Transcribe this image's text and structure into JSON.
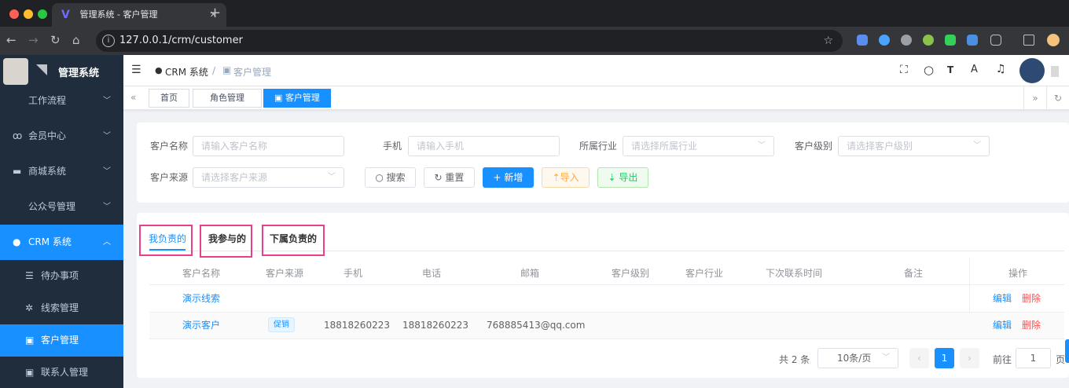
{
  "browser": {
    "tab_title": "管理系统 - 客户管理",
    "url": "127.0.0.1/crm/customer",
    "new_tab": "+",
    "close": "✕"
  },
  "logo": {
    "title": "管理系统"
  },
  "sidebar": {
    "items": [
      {
        "label": "工作流程",
        "icon": "chevron"
      },
      {
        "label": "会员中心",
        "icon": "members-icon"
      },
      {
        "label": "商城系统",
        "icon": "shop-icon"
      },
      {
        "label": "公众号管理",
        "icon": "chevron"
      },
      {
        "label": "CRM 系统",
        "icon": "user-icon"
      },
      {
        "label": "待办事项",
        "icon": "list-icon"
      },
      {
        "label": "线索管理",
        "icon": "clue-icon"
      },
      {
        "label": "客户管理",
        "icon": "customer-icon"
      },
      {
        "label": "联系人管理",
        "icon": "contact-icon"
      }
    ]
  },
  "navbar": {
    "breadcrumb_1": "CRM 系统",
    "breadcrumb_sep": "/",
    "breadcrumb_2": "客户管理"
  },
  "tags": {
    "items": [
      "首页",
      "角色管理",
      "客户管理"
    ]
  },
  "filters": {
    "name_label": "客户名称",
    "name_placeholder": "请输入客户名称",
    "phone_label": "手机",
    "phone_placeholder": "请输入手机",
    "industry_label": "所属行业",
    "industry_placeholder": "请选择所属行业",
    "level_label": "客户级别",
    "level_placeholder": "请选择客户级别",
    "source_label": "客户来源",
    "source_placeholder": "请选择客户来源",
    "search": "搜索",
    "reset": "重置",
    "add": "新增",
    "import": "导入",
    "export": "导出"
  },
  "list_tabs": [
    "我负责的",
    "我参与的",
    "下属负责的"
  ],
  "table": {
    "columns": [
      "客户名称",
      "客户来源",
      "手机",
      "电话",
      "邮箱",
      "客户级别",
      "客户行业",
      "下次联系时间",
      "备注",
      "操作"
    ],
    "rows": [
      {
        "name": "演示线索",
        "source": "",
        "mobile": "",
        "phone": "",
        "email": "",
        "edit": "编辑",
        "delete": "删除"
      },
      {
        "name": "演示客户",
        "source": "促销",
        "mobile": "18818260223",
        "phone": "18818260223",
        "email": "768885413@qq.com",
        "edit": "编辑",
        "delete": "删除"
      }
    ]
  },
  "pagination": {
    "total": "共 2 条",
    "page_size": "10条/页",
    "current": "1",
    "goto_label": "前往",
    "goto_value": "1",
    "page_suffix": "页"
  },
  "colors": {
    "primary": "#1890ff",
    "sidebar": "#1f2d3d",
    "danger": "#ff4d4f",
    "highlight": "#e8408a"
  }
}
